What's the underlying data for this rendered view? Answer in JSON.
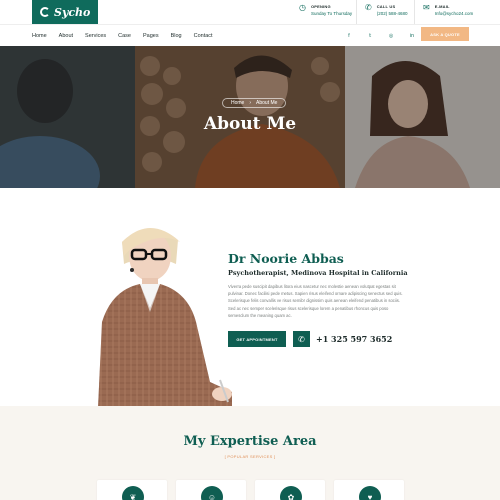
{
  "brand": {
    "name": "Sycho",
    "primary_color": "#0f5e52",
    "accent_color": "#f2b884"
  },
  "topbar": {
    "opening": {
      "label": "OPENING",
      "value": "Sunday To Thursday",
      "icon": "clock-icon"
    },
    "call": {
      "label": "CALL US",
      "value": "(202) 588-4680",
      "icon": "phone-icon"
    },
    "email": {
      "label": "E-MAIL",
      "value": "Info@sycho24.com",
      "icon": "mail-icon"
    }
  },
  "nav": {
    "links": [
      "Home",
      "About",
      "Services",
      "Case",
      "Pages",
      "Blog",
      "Contact"
    ],
    "socials": [
      "facebook-icon",
      "twitter-icon",
      "instagram-icon",
      "linkedin-icon",
      "youtube-icon"
    ],
    "quote_button": "ASK A QUOTE"
  },
  "hero": {
    "breadcrumb": [
      "Home",
      "About Me"
    ],
    "title": "About Me"
  },
  "profile": {
    "name": "Dr Noorie Abbas",
    "role": "Psychotherapist, Medinova Hospital in California",
    "bio": "Viverra pede suscipit dapibus litora eius nascetur nec molestie aenean volutpat egestas sit pulvinar. Donec facilisi pede metus. Sapien risus eleifend ornare adipiscing senectus sed quis. Scelerisque felis convallis ve risus semibr dignissim quis aenean eleifend penatibus in sociis. Sed ac nec semper scelerisque risus scelerisque lorem a penatibus rhoncus quis poso semesclum the meaning quam ac.",
    "appointment_button": "GET APPOINTMENT",
    "phone": "+1 325 597 3652"
  },
  "expertise": {
    "title": "My Expertise Area",
    "subtitle": "[ POPULAR SERVICES ]",
    "cards": [
      {
        "icon": "brain-care-icon"
      },
      {
        "icon": "therapy-icon"
      },
      {
        "icon": "mind-icon"
      },
      {
        "icon": "heart-icon"
      }
    ]
  }
}
